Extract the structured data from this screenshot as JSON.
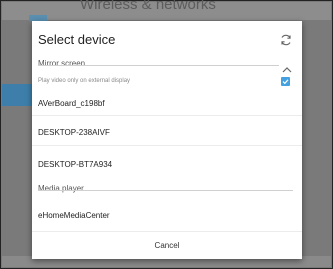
{
  "background": {
    "title": "Wireless & networks"
  },
  "dialog": {
    "title": "Select device",
    "refresh_icon": "refresh-icon",
    "sections": {
      "mirror": {
        "label": "Mirror screen",
        "collapse_icon": "chevron-up-icon",
        "option_text": "Play video only on external display",
        "option_checked": true,
        "devices": [
          "AVerBoard_c198bf",
          "DESKTOP-238AIVF",
          "DESKTOP-BT7A934"
        ]
      },
      "media": {
        "label": "Media player",
        "devices": [
          "eHomeMediaCenter"
        ]
      }
    },
    "cancel_label": "Cancel"
  },
  "colors": {
    "accent": "#45a0df",
    "overlay": "#7a7a7a"
  }
}
